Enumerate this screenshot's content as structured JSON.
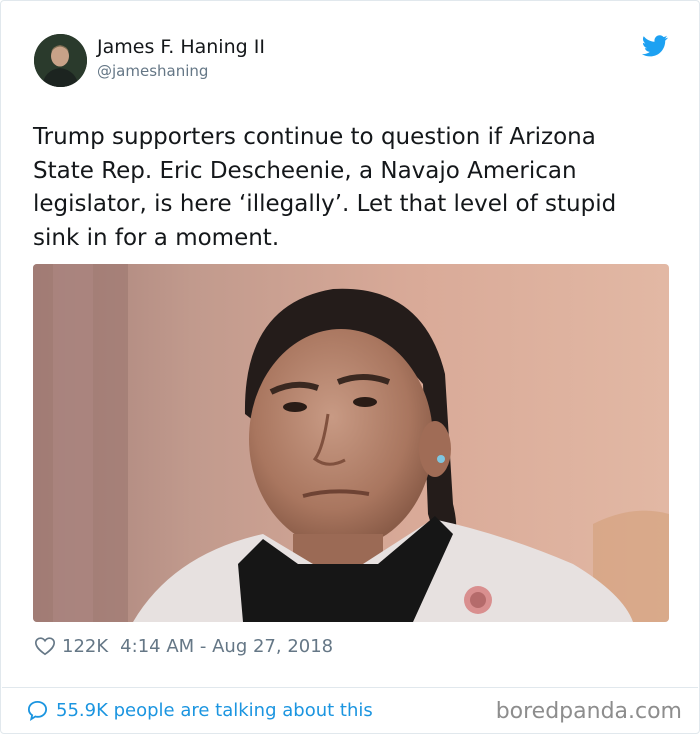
{
  "tweet": {
    "author": {
      "display_name": "James F. Haning II",
      "handle": "@jameshaning",
      "avatar_icon": "profile-photo"
    },
    "platform_icon": "twitter-bird-icon",
    "brand_color": "#1da1f2",
    "text": "Trump supporters continue to question if Arizona State Rep. Eric Descheenie, a Navajo American legislator, is here ‘illegally’. Let that level of stupid sink in for a moment.",
    "photo": {
      "subject": "portrait-photo"
    },
    "likes": "122K",
    "timestamp": "4:14 AM - Aug 27, 2018",
    "talking": "55.9K people are talking about this"
  },
  "watermark": "boredpanda.com"
}
